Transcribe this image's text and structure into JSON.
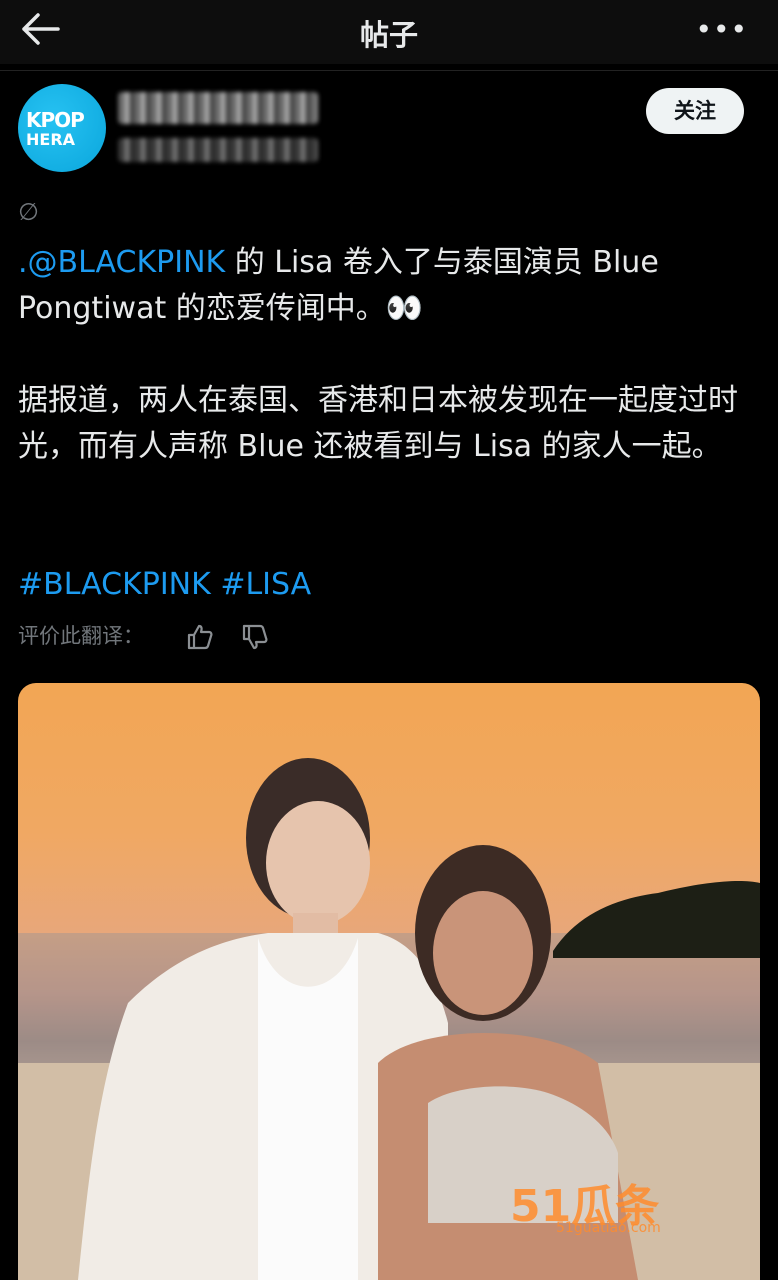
{
  "topbar": {
    "title": "帖子",
    "back_icon": "arrow-left-icon",
    "more_label": "•••"
  },
  "author": {
    "avatar_text_1": "KPOP",
    "avatar_text_2": "HERA",
    "follow_label": "关注"
  },
  "post": {
    "no_symbol": "∅",
    "p1_mention": ".@BLACKPINK",
    "p1_rest": " 的 Lisa 卷入了与泰国演员 Blue Pongtiwat 的恋爱传闻中。👀",
    "p2": "据报道，两人在泰国、香港和日本被发现在一起度过时光，而有人声称 Blue 还被看到与 Lisa 的家人一起。",
    "hashtags": "#BLACKPINK #LISA",
    "rate_label": "评价此翻译："
  },
  "media": {
    "watermark": "51瓜条",
    "watermark_url": "51guatiao.com"
  }
}
